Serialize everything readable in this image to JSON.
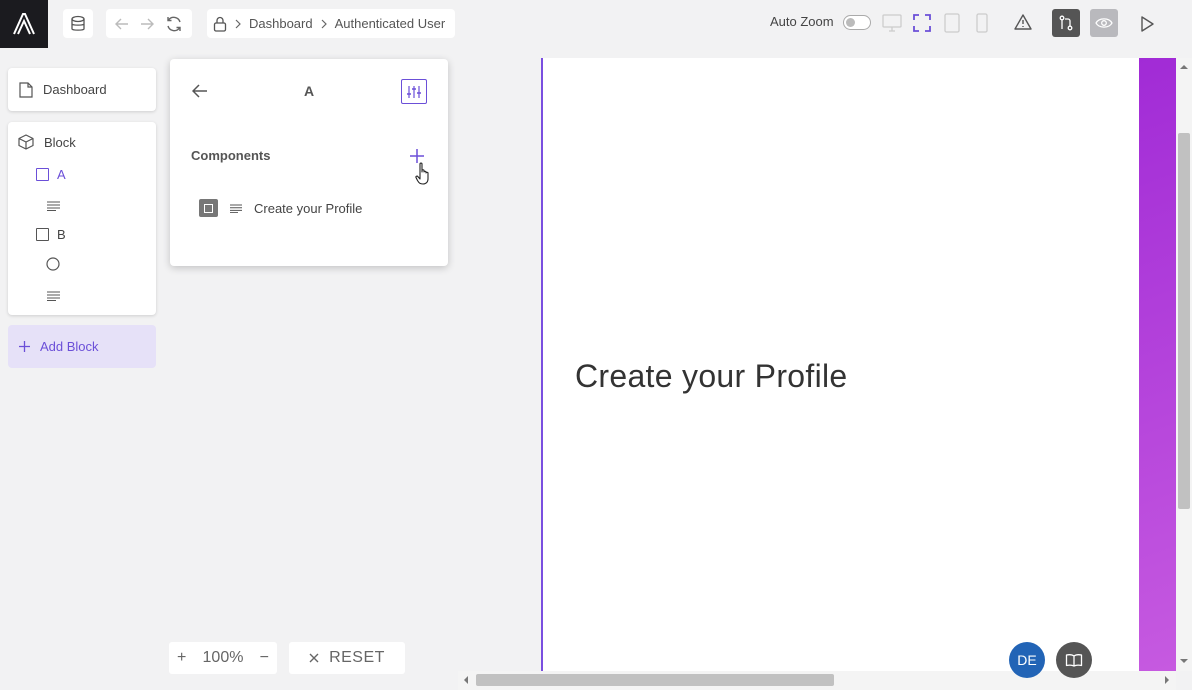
{
  "topbar": {
    "breadcrumb": [
      "Dashboard",
      "Authenticated User"
    ],
    "auto_zoom_label": "Auto Zoom"
  },
  "sidebar": {
    "dashboard_label": "Dashboard",
    "block_label": "Block",
    "items": [
      {
        "label": "A",
        "type": "container",
        "selected": true
      },
      {
        "label": "",
        "type": "text"
      },
      {
        "label": "B",
        "type": "container",
        "selected": false
      },
      {
        "label": "",
        "type": "circle"
      },
      {
        "label": "",
        "type": "text"
      }
    ],
    "add_block_label": "Add Block"
  },
  "panel": {
    "title": "A",
    "components_label": "Components",
    "component_item_label": "Create your Profile"
  },
  "canvas": {
    "heading": "Create your Profile"
  },
  "zoom": {
    "plus": "+",
    "value": "100%",
    "minus": "−"
  },
  "reset_label": "RESET",
  "avatar_initials": "DE",
  "colors": {
    "accent": "#6b4fd8",
    "accent_light": "#e6e1f8",
    "dark": "#1b1b1f",
    "gradient_start": "#a12bd6",
    "avatar_blue": "#2264b6",
    "book_gray": "#555555"
  }
}
